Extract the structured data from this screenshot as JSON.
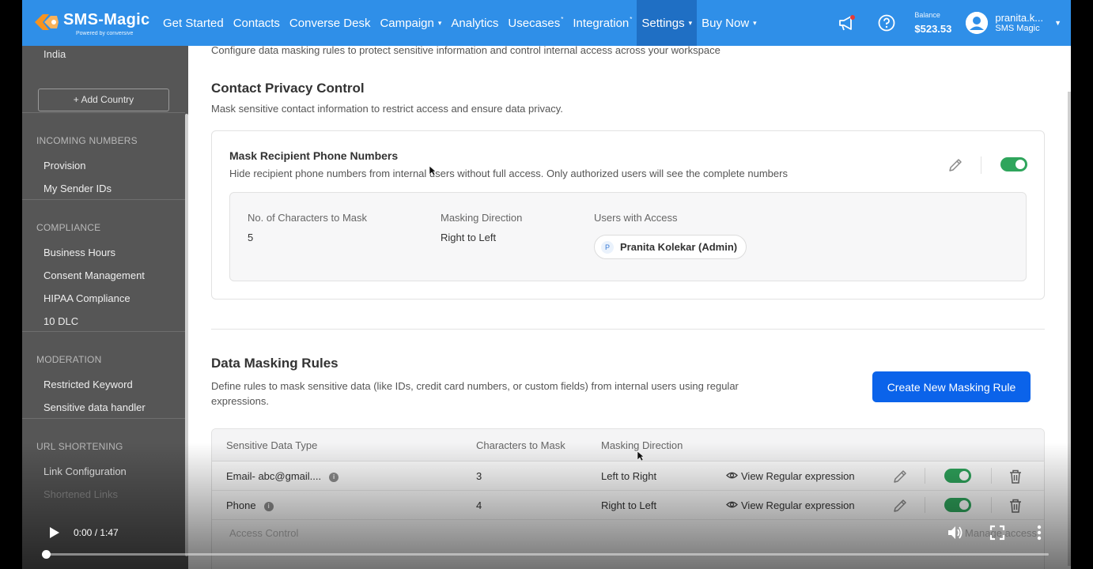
{
  "nav": {
    "brand": "SMS-Magic",
    "powered_by": "Powered by conversive",
    "items": [
      {
        "label": "Get Started"
      },
      {
        "label": "Contacts"
      },
      {
        "label": "Converse Desk"
      },
      {
        "label": "Campaign",
        "caret": "▾"
      },
      {
        "label": "Analytics"
      },
      {
        "label": "Usecases",
        "sup": "*"
      },
      {
        "label": "Integration",
        "sup": "*"
      },
      {
        "label": "Settings",
        "caret": "▾",
        "active": true
      },
      {
        "label": "Buy Now",
        "caret": "▾"
      }
    ],
    "balance_label": "Balance",
    "balance_value": "$523.53",
    "user_name": "pranita.k...",
    "user_org": "SMS Magic",
    "accent": "#2f8fe8"
  },
  "sidebar": {
    "country": "India",
    "add_country": "+ Add Country",
    "sections": [
      {
        "head": "INCOMING NUMBERS",
        "items": [
          "Provision",
          "My Sender IDs"
        ]
      },
      {
        "head": "COMPLIANCE",
        "items": [
          "Business Hours",
          "Consent Management",
          "HIPAA Compliance",
          "10 DLC"
        ]
      },
      {
        "head": "MODERATION",
        "items": [
          "Restricted Keyword",
          "Sensitive data handler"
        ]
      },
      {
        "head": "URL SHORTENING",
        "items": [
          "Link Configuration",
          "Shortened Links"
        ]
      }
    ]
  },
  "main": {
    "intro": "Configure data masking rules to protect sensitive information and control internal access across your workspace",
    "cpc_title": "Contact Privacy Control",
    "cpc_desc": "Mask sensitive contact information to restrict access and ensure data privacy.",
    "mask": {
      "title": "Mask Recipient Phone Numbers",
      "desc": "Hide recipient phone numbers from internal users without full access. Only authorized users will see the complete numbers",
      "enabled": true,
      "chars_label": "No. of Characters to Mask",
      "chars_value": "5",
      "direction_label": "Masking Direction",
      "direction_value": "Right to Left",
      "users_label": "Users with Access",
      "user_initial": "P",
      "user_name": "Pranita Kolekar (Admin)"
    },
    "dmr_title": "Data Masking Rules",
    "dmr_desc": "Define rules to mask sensitive data (like IDs, credit card numbers, or custom fields) from internal users using regular expressions.",
    "create_btn": "Create New Masking Rule",
    "table": {
      "headers": [
        "Sensitive Data Type",
        "Characters to Mask",
        "Masking Direction"
      ],
      "rows": [
        {
          "type": "Email- abc@gmail....",
          "chars": "3",
          "direction": "Left to Right",
          "view": "View Regular expression",
          "enabled": true
        },
        {
          "type": "Phone",
          "chars": "4",
          "direction": "Right to Left",
          "view": "View Regular expression",
          "enabled": true
        }
      ],
      "faded_row": "Access Control",
      "faded_right": "Manage access"
    },
    "toggle_on_color": "#2fa55c",
    "button_color": "#0b63ea"
  },
  "video": {
    "time": "0:00 / 1:47",
    "progress": 0
  }
}
